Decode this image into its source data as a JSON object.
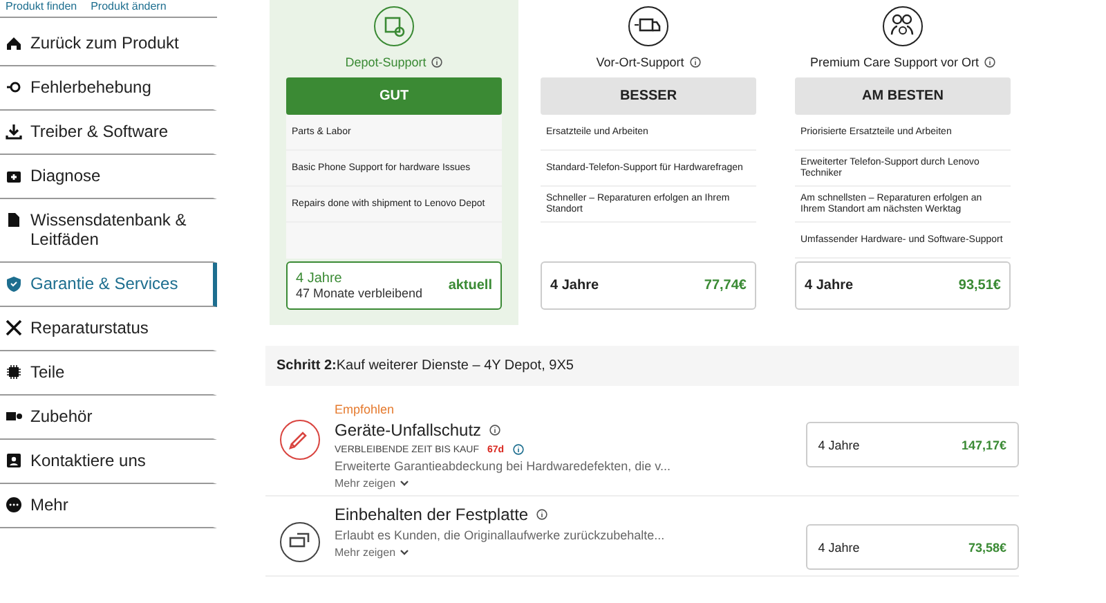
{
  "top_links": [
    "Produkt finden",
    "Produkt ändern"
  ],
  "sidebar": {
    "items": [
      {
        "label": "Zurück zum Produkt",
        "selected": false
      },
      {
        "label": "Fehlerbehebung",
        "selected": false
      },
      {
        "label": "Treiber & Software",
        "selected": false
      },
      {
        "label": "Diagnose",
        "selected": false
      },
      {
        "label": "Wissensdatenbank & Leitfäden",
        "selected": false
      },
      {
        "label": "Garantie & Services",
        "selected": true
      },
      {
        "label": "Reparaturstatus",
        "selected": false
      },
      {
        "label": "Teile",
        "selected": false
      },
      {
        "label": "Zubehör",
        "selected": false
      },
      {
        "label": "Kontaktiere uns",
        "selected": false
      },
      {
        "label": "Mehr",
        "selected": false
      }
    ]
  },
  "plans": [
    {
      "name": "Depot-Support",
      "tier": "GUT",
      "selected": true,
      "features": [
        "Parts & Labor",
        "Basic Phone Support for hardware Issues",
        "Repairs done with shipment to Lenovo Depot"
      ],
      "price": {
        "kind": "current",
        "term": "4 Jahre",
        "note": "47 Monate verbleibend",
        "status": "aktuell"
      }
    },
    {
      "name": "Vor-Ort-Support",
      "tier": "BESSER",
      "selected": false,
      "features": [
        "Ersatzteile und Arbeiten",
        "Standard-Telefon-Support für Hardwarefragen",
        "Schneller – Reparaturen erfolgen an Ihrem Standort"
      ],
      "price": {
        "kind": "offer",
        "term": "4 Jahre",
        "price": "77,74€"
      }
    },
    {
      "name": "Premium Care Support vor Ort",
      "tier": "AM BESTEN",
      "selected": false,
      "features": [
        "Priorisierte Ersatzteile und Arbeiten",
        "Erweiterter Telefon-Support durch Lenovo Techniker",
        "Am schnellsten – Reparaturen erfolgen an Ihrem Standort am nächsten Werktag",
        "Umfassender Hardware- und Software-Support"
      ],
      "price": {
        "kind": "offer",
        "term": "4 Jahre",
        "price": "93,51€"
      }
    }
  ],
  "step2": {
    "label": "Schritt 2:",
    "title": "Kauf weiterer Dienste – 4Y Depot, 9X5"
  },
  "services": [
    {
      "tag": "Empfohlen",
      "title": "Geräte-Unfallschutz",
      "countdown": {
        "label": "VERBLEIBENDE ZEIT BIS KAUF",
        "value": "67d"
      },
      "description": "Erweiterte Garantieabdeckung bei Hardwaredefekten, die v...",
      "more": "Mehr zeigen",
      "term": "4 Jahre",
      "price": "147,17€"
    },
    {
      "title": "Einbehalten der Festplatte",
      "description": "Erlaubt es Kunden, die Originallaufwerke zurückzubehalte...",
      "more": "Mehr zeigen",
      "term": "4 Jahre",
      "price": "73,58€"
    }
  ]
}
